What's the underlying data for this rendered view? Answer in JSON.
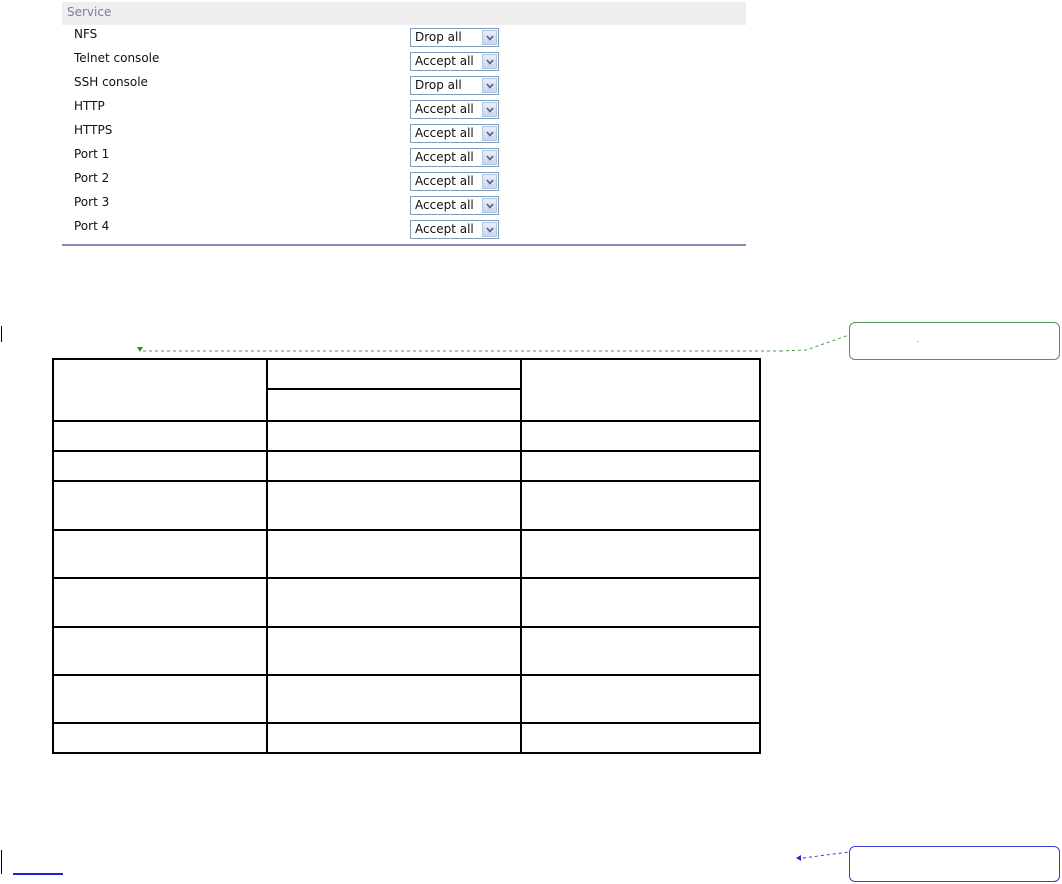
{
  "service": {
    "header": "Service",
    "rows": [
      {
        "name": "NFS",
        "value": "Drop all"
      },
      {
        "name": "Telnet console",
        "value": "Accept all"
      },
      {
        "name": "SSH console",
        "value": "Drop all"
      },
      {
        "name": "HTTP",
        "value": "Accept all"
      },
      {
        "name": "HTTPS",
        "value": "Accept all"
      },
      {
        "name": "Port 1",
        "value": "Accept all"
      },
      {
        "name": "Port 2",
        "value": "Accept all"
      },
      {
        "name": "Port 3",
        "value": "Accept all"
      },
      {
        "name": "Port 4",
        "value": "Accept all"
      }
    ]
  },
  "colors": {
    "header_bg": "#eeeeee",
    "header_text": "#7a7ca8",
    "divider": "#8a8ab0",
    "select_border": "#7f9db9",
    "comment_green": "#4e9a4e",
    "comment_blue": "#3b3bd6",
    "link_blue": "#1f1fd6"
  },
  "icons": {
    "select_arrow": "chevron-down-icon",
    "anchor_marker": "triangle-marker-icon"
  }
}
